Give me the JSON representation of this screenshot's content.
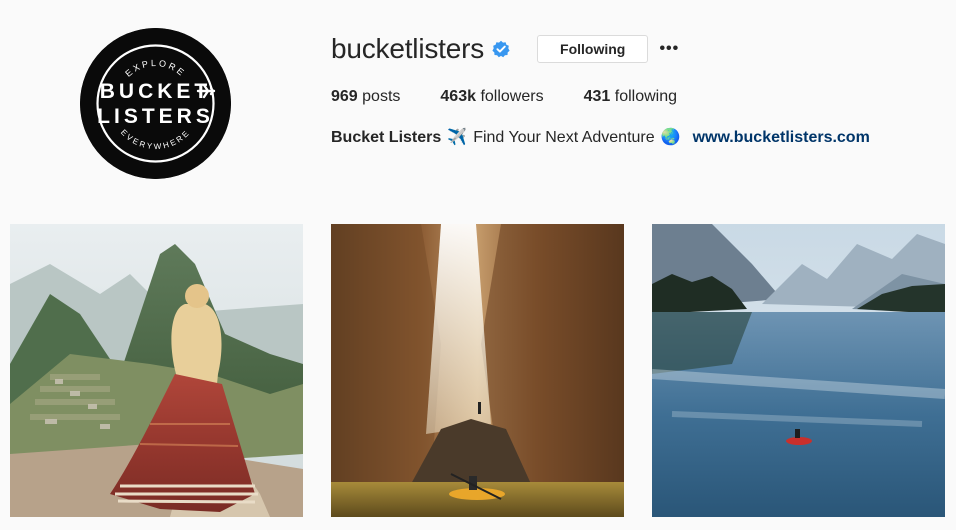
{
  "profile": {
    "username": "bucketlisters",
    "verified": true,
    "follow_label": "Following",
    "more_label": "•••",
    "avatar_text": {
      "top_arc": "EXPLORE",
      "line1": "BUCKET",
      "line2": "LISTERS",
      "bottom_arc": "EVERYWHERE"
    }
  },
  "stats": {
    "posts_count": "969",
    "posts_label": "posts",
    "followers_count": "463k",
    "followers_label": "followers",
    "following_count": "431",
    "following_label": "following"
  },
  "bio": {
    "name": "Bucket Listers",
    "emoji1": "✈️",
    "text": "Find Your Next Adventure",
    "emoji2": "🌏",
    "link": "www.bucketlisters.com"
  },
  "posts": [
    {
      "subject": "woman in red dress overlooking mountain ruins"
    },
    {
      "subject": "kayaker in sunlit canyon cave"
    },
    {
      "subject": "red canoe on mountain lake"
    }
  ],
  "colors": {
    "background": "#fafafa",
    "text": "#262626",
    "link": "#003569",
    "verified_badge": "#3897f0",
    "button_border": "#dbdbdb"
  }
}
